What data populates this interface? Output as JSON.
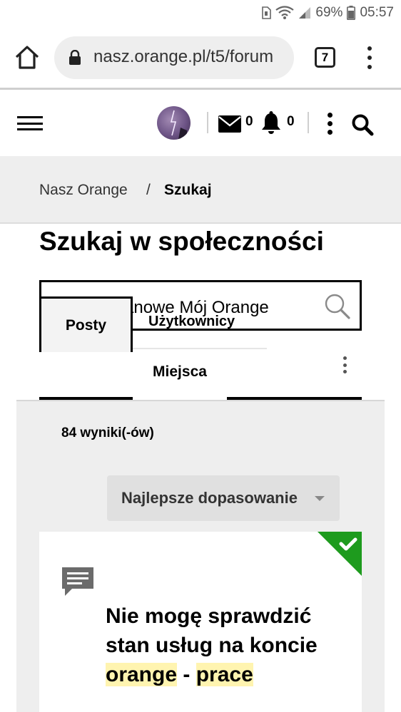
{
  "status_bar": {
    "battery_percent": "69%",
    "time": "05:57"
  },
  "browser": {
    "url": "nasz.orange.pl/t5/forum",
    "tab_count": "7"
  },
  "header": {
    "messages_count": "0",
    "notifications_count": "0"
  },
  "breadcrumb": {
    "home": "Nasz Orange",
    "separator": "/",
    "current": "Szukaj"
  },
  "page": {
    "title": "Szukaj w społeczności"
  },
  "search": {
    "value": "anowe Mój Orange"
  },
  "tabs": {
    "posts": "Posty",
    "users": "Użytkownicy",
    "places": "Miejsca"
  },
  "results": {
    "count_label": "84 wyniki(-ów)",
    "sort_label": "Najlepsze dopasowanie",
    "first_result": {
      "title_part1": "Nie mogę sprawdzić stan usług na koncie",
      "title_hl1": "orange",
      "title_dash": "-",
      "title_hl2": "prace"
    }
  },
  "colors": {
    "solved_badge": "#1e9b1e",
    "highlight": "#fff4b0",
    "breadcrumb_bg": "#eeeeee"
  },
  "icons": [
    "sim-icon",
    "wifi-icon",
    "signal-icon",
    "battery-icon",
    "home-icon",
    "lock-icon",
    "menu-icon",
    "mail-icon",
    "bell-icon",
    "more-vert-icon",
    "search-icon",
    "message-icon",
    "checkmark-icon"
  ]
}
